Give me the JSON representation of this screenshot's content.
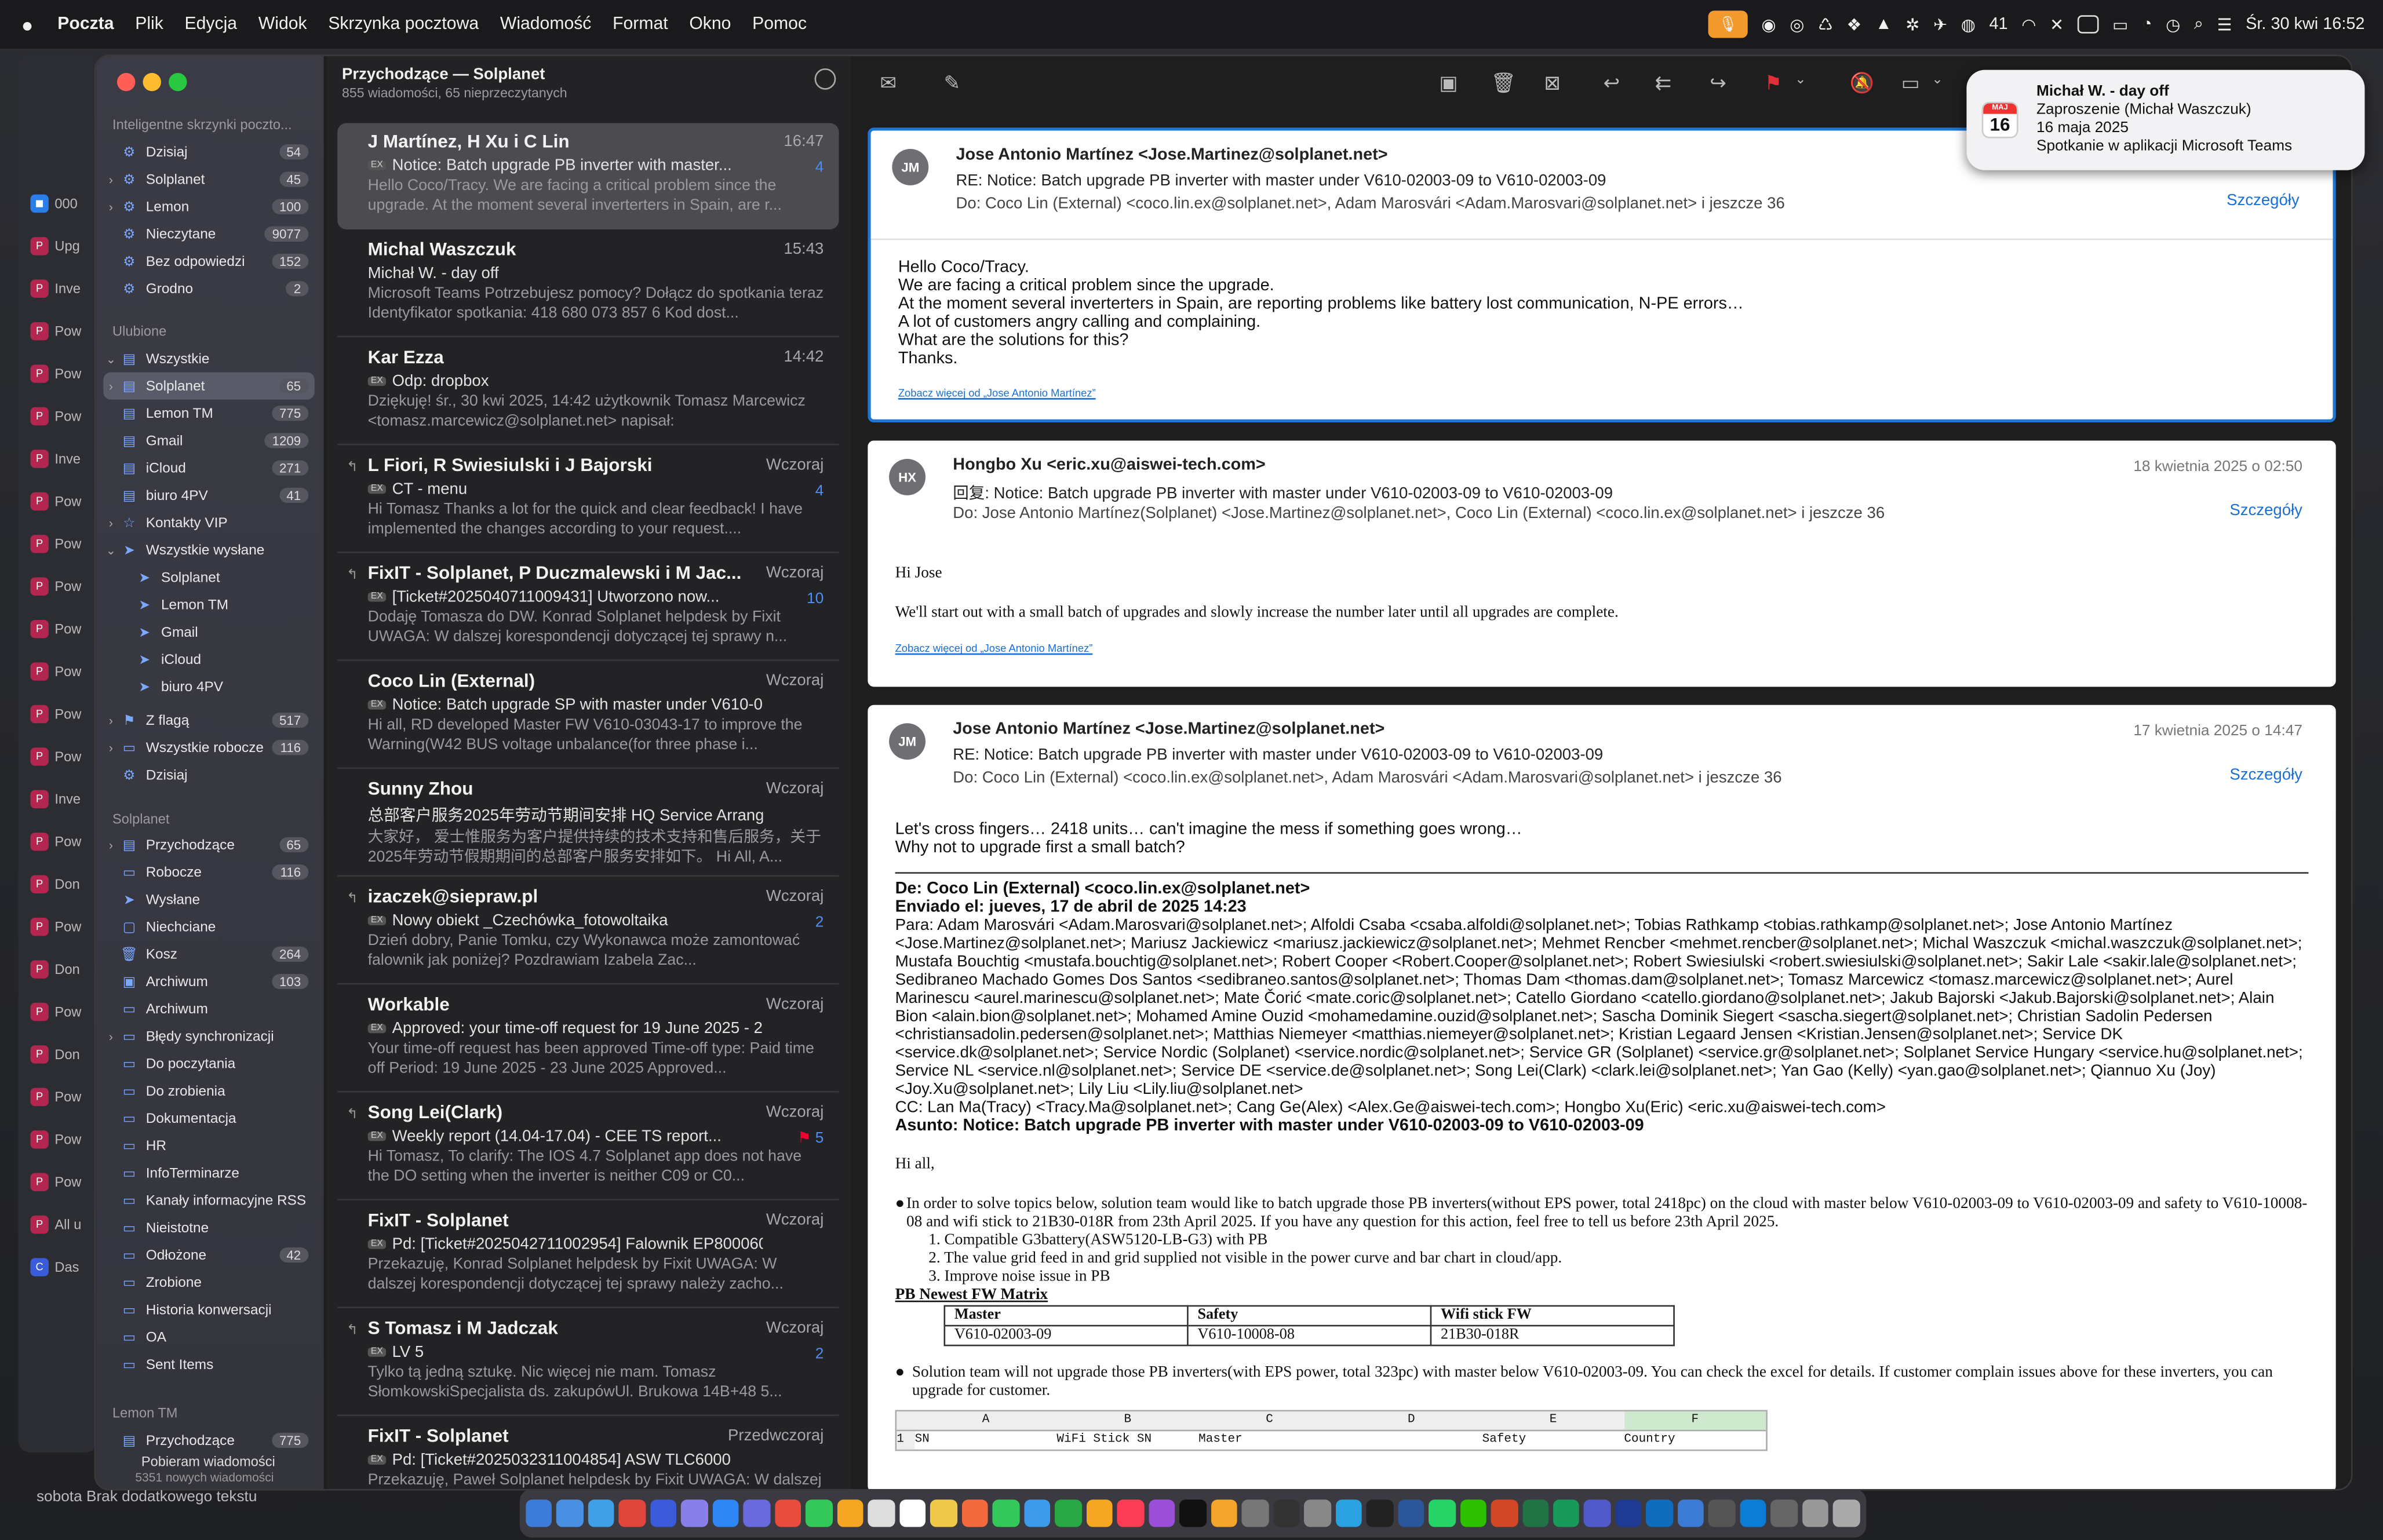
{
  "menubar": {
    "app": "Poczta",
    "items": [
      "Plik",
      "Edycja",
      "Widok",
      "Skrzynka pocztowa",
      "Wiadomość",
      "Format",
      "Okno",
      "Pomoc"
    ],
    "status_count": "41",
    "clock": "Śr. 30 kwi  16:52"
  },
  "sidebar": {
    "smart_header": "Inteligentne skrzynki poczto...",
    "smart": [
      {
        "label": "Dzisiaj",
        "count": "54"
      },
      {
        "label": "Solplanet",
        "count": "45"
      },
      {
        "label": "Lemon",
        "count": "100"
      },
      {
        "label": "Nieczytane",
        "count": "9077"
      },
      {
        "label": "Bez odpowiedzi",
        "count": "152"
      },
      {
        "label": "Grodno",
        "count": "2"
      }
    ],
    "fav_header": "Ulubione",
    "fav": [
      {
        "label": "Wszystkie",
        "count": ""
      },
      {
        "label": "Solplanet",
        "count": "65"
      },
      {
        "label": "Lemon TM",
        "count": "775"
      },
      {
        "label": "Gmail",
        "count": "1209"
      },
      {
        "label": "iCloud",
        "count": "271"
      },
      {
        "label": "biuro 4PV",
        "count": "41"
      },
      {
        "label": "Kontakty VIP",
        "count": ""
      },
      {
        "label": "Wszystkie wysłane",
        "count": ""
      },
      {
        "label": "Solplanet",
        "count": ""
      },
      {
        "label": "Lemon TM",
        "count": ""
      },
      {
        "label": "Gmail",
        "count": ""
      },
      {
        "label": "iCloud",
        "count": ""
      },
      {
        "label": "biuro 4PV",
        "count": ""
      },
      {
        "label": "Z flagą",
        "count": "517"
      },
      {
        "label": "Wszystkie robocze",
        "count": "116"
      },
      {
        "label": "Dzisiaj",
        "count": ""
      }
    ],
    "sol_header": "Solplanet",
    "sol": [
      {
        "label": "Przychodzące",
        "count": "65"
      },
      {
        "label": "Robocze",
        "count": "116"
      },
      {
        "label": "Wysłane",
        "count": ""
      },
      {
        "label": "Niechciane",
        "count": ""
      },
      {
        "label": "Kosz",
        "count": "264"
      },
      {
        "label": "Archiwum",
        "count": "103"
      },
      {
        "label": "Archiwum",
        "count": ""
      },
      {
        "label": "Błędy synchronizacji",
        "count": ""
      },
      {
        "label": "Do poczytania",
        "count": ""
      },
      {
        "label": "Do zrobienia",
        "count": ""
      },
      {
        "label": "Dokumentacja",
        "count": ""
      },
      {
        "label": "HR",
        "count": ""
      },
      {
        "label": "InfoTerminarze",
        "count": ""
      },
      {
        "label": "Kanały informacyjne RSS",
        "count": ""
      },
      {
        "label": "Nieistotne",
        "count": ""
      },
      {
        "label": "Odłożone",
        "count": "42"
      },
      {
        "label": "Zrobione",
        "count": ""
      },
      {
        "label": "Historia konwersacji",
        "count": ""
      },
      {
        "label": "OA",
        "count": ""
      },
      {
        "label": "Sent Items",
        "count": ""
      }
    ],
    "lemon_header": "Lemon TM",
    "lemon": [
      {
        "label": "Przychodzące",
        "count": "775"
      }
    ],
    "status1": "Pobieram wiadomości",
    "status2": "5351 nowych wiadomości"
  },
  "list": {
    "title": "Przychodzące — Solplanet",
    "sub": "855 wiadomości, 65 nieprzeczytanych",
    "messages": [
      {
        "from": "J Martínez, H Xu i C Lin",
        "time": "16:47",
        "subj": "Notice: Batch upgrade PB inverter with master...",
        "prev": "Hello Coco/Tracy. We are facing a critical problem since the upgrade. At the moment several inverterters in Spain, are r...",
        "count": "4"
      },
      {
        "from": "Michal Waszczuk",
        "time": "15:43",
        "subj": "Michał W. - day off",
        "prev": "Microsoft Teams Potrzebujesz pomocy? Dołącz do spotkania teraz Identyfikator spotkania: 418 680 073 857 6 Kod dost...",
        "count": ""
      },
      {
        "from": "Kar Ezza",
        "time": "14:42",
        "subj": "Odp: dropbox",
        "prev": "Dziękuję! śr., 30 kwi 2025, 14:42 użytkownik Tomasz Marcewicz <tomasz.marcewicz@solplanet.net> napisał:",
        "count": ""
      },
      {
        "from": "L Fiori, R Swiesiulski i J Bajorski",
        "time": "Wczoraj",
        "subj": "CT - menu",
        "prev": "Hi Tomasz Thanks a lot for the quick and clear feedback! I have implemented the changes according to your request....",
        "count": "4"
      },
      {
        "from": "FixIT - Solplanet, P Duczmalewski i M Jac...",
        "time": "Wczoraj",
        "subj": "[Ticket#2025040711009431] Utworzono now...",
        "prev": "Dodaję Tomasza do DW. Konrad Solplanet helpdesk by Fixit UWAGA: W dalszej korespondencji dotyczącej tej sprawy n...",
        "count": "10"
      },
      {
        "from": "Coco Lin (External)",
        "time": "Wczoraj",
        "subj": "Notice: Batch upgrade SP with master under V610-03...",
        "prev": "Hi all, RD developed Master FW V610-03043-17 to improve the Warning(W42 BUS voltage unbalance(for three phase i...",
        "count": ""
      },
      {
        "from": "Sunny Zhou",
        "time": "Wczoraj",
        "subj": "总部客户服务2025年劳动节期间安排 HQ Service Arrange...",
        "prev": "大家好， 爱士惟服务为客户提供持续的技术支持和售后服务，关于2025年劳动节假期期间的总部客户服务安排如下。 Hi All, A...",
        "count": ""
      },
      {
        "from": "izaczek@siepraw.pl",
        "time": "Wczoraj",
        "subj": "Nowy obiekt _Czechówka_fotowoltaika",
        "prev": "Dzień dobry, Panie Tomku, czy Wykonawca może zamontować falownik jak poniżej? Pozdrawiam Izabela Zac...",
        "count": "2"
      },
      {
        "from": "Workable",
        "time": "Wczoraj",
        "subj": "Approved: your time-off request for 19 June 2025 - 2...",
        "prev": "Your time-off request has been approved Time-off type: Paid time off Period: 19 June 2025 - 23 June 2025 Approved...",
        "count": ""
      },
      {
        "from": "Song Lei(Clark)",
        "time": "Wczoraj",
        "subj": "Weekly report (14.04-17.04) - CEE TS report...",
        "prev": "Hi Tomasz, To clarify: The IOS 4.7 Solplanet app does not have the DO setting when the inverter is neither C09 or C0...",
        "count": "5"
      },
      {
        "from": "FixIT - Solplanet",
        "time": "Wczoraj",
        "subj": "Pd: [Ticket#2025042711002954] Falownik EP800060...",
        "prev": "Przekazuję, Konrad Solplanet helpdesk by Fixit UWAGA: W dalszej korespondencji dotyczącej tej sprawy należy zacho...",
        "count": ""
      },
      {
        "from": "S Tomasz i M Jadczak",
        "time": "Wczoraj",
        "subj": "LV 5",
        "prev": "Tylko tą jedną sztukę. Nic więcej nie mam. Tomasz SłomkowskiSpecjalista ds. zakupówUl. Brukowa 14B+48 5...",
        "count": "2"
      },
      {
        "from": "FixIT - Solplanet",
        "time": "Przedwczoraj",
        "subj": "Pd: [Ticket#2025032311004854] ASW TLC6000",
        "prev": "Przekazuję, Paweł Solplanet helpdesk by Fixit UWAGA: W dalszej korespondencji dotyczącej tej sprawy należy zacho...",
        "count": ""
      }
    ]
  },
  "reader": {
    "m1": {
      "initials": "JM",
      "from": "Jose Antonio Martínez <Jose.Martinez@solplanet.net>",
      "subj": "RE: Notice: Batch upgrade PB inverter with master under V610-02003-09 to V610-02003-09",
      "to": "Do:  Coco Lin (External) <coco.lin.ex@solplanet.net>,    Adam Marosvári <Adam.Marosvari@solplanet.net>    i jeszcze 36",
      "details": "Szczegóły",
      "lines": [
        "Hello Coco/Tracy.",
        "We are facing a critical problem since the upgrade.",
        "At the moment several inverterters in Spain, are reporting problems like battery lost communication, N-PE errors…",
        "A lot of customers angry calling and complaining.",
        "What are the solutions for this?",
        "Thanks."
      ],
      "more": "Zobacz więcej od „Jose Antonio Martínez”"
    },
    "m2": {
      "initials": "HX",
      "from": "Hongbo Xu <eric.xu@aiswei-tech.com>",
      "date": "18 kwietnia 2025 o 02:50",
      "subj": "回复: Notice: Batch upgrade PB inverter with master under V610-02003-09 to V610-02003-09",
      "to": "Do:  Jose Antonio Martínez(Solplanet) <Jose.Martinez@solplanet.net>,    Coco Lin (External) <coco.lin.ex@solplanet.net>    i jeszcze 36",
      "details": "Szczegóły",
      "l1": "Hi Jose",
      "l2": "We'll start out with a small batch of upgrades and slowly increase the number later until all upgrades are complete.",
      "more": "Zobacz więcej od „Jose Antonio Martínez”"
    },
    "m3": {
      "initials": "JM",
      "from": "Jose Antonio Martínez <Jose.Martinez@solplanet.net>",
      "date": "17 kwietnia 2025 o 14:47",
      "subj": "RE: Notice: Batch upgrade PB inverter with master under V610-02003-09 to V610-02003-09",
      "to": "Do:  Coco Lin (External) <coco.lin.ex@solplanet.net>,    Adam Marosvári <Adam.Marosvari@solplanet.net>    i jeszcze 36",
      "details": "Szczegóły",
      "l1": "Let's cross fingers… 2418 units… can't imagine the mess if something goes wrong…",
      "l2": "Why not to upgrade first a small batch?",
      "de": "De: Coco Lin (External) <coco.lin.ex@solplanet.net>",
      "enviado": "Enviado el: jueves, 17 de abril de 2025 14:23",
      "para": "Para: Adam Marosvári <Adam.Marosvari@solplanet.net>; Alfoldi Csaba <csaba.alfoldi@solplanet.net>; Tobias Rathkamp <tobias.rathkamp@solplanet.net>; Jose Antonio Martínez <Jose.Martinez@solplanet.net>; Mariusz Jackiewicz <mariusz.jackiewicz@solplanet.net>; Mehmet Rencber <mehmet.rencber@solplanet.net>; Michal Waszczuk <michal.waszczuk@solplanet.net>; Mustafa Bouchtig <mustafa.bouchtig@solplanet.net>; Robert Cooper <Robert.Cooper@solplanet.net>; Robert Swiesiulski <robert.swiesiulski@solplanet.net>; Sakir Lale <sakir.lale@solplanet.net>; Sedibraneo Machado Gomes Dos Santos <sedibraneo.santos@solplanet.net>; Thomas Dam <thomas.dam@solplanet.net>; Tomasz Marcewicz <tomasz.marcewicz@solplanet.net>; Aurel Marinescu <aurel.marinescu@solplanet.net>; Mate Čorić <mate.coric@solplanet.net>; Catello Giordano <catello.giordano@solplanet.net>; Jakub Bajorski <Jakub.Bajorski@solplanet.net>; Alain Bion <alain.bion@solplanet.net>; Mohamed Amine Ouzid <mohamedamine.ouzid@solplanet.net>; Sascha Dominik Siegert <sascha.siegert@solplanet.net>; Christian Sadolin Pedersen <christiansadolin.pedersen@solplanet.net>; Matthias Niemeyer <matthias.niemeyer@solplanet.net>; Kristian Legaard Jensen <Kristian.Jensen@solplanet.net>; Service DK <service.dk@solplanet.net>; Service Nordic (Solplanet) <service.nordic@solplanet.net>; Service GR (Solplanet) <service.gr@solplanet.net>; Solplanet Service Hungary <service.hu@solplanet.net>; Service NL <service.nl@solplanet.net>; Service DE <service.de@solplanet.net>; Song Lei(Clark) <clark.lei@solplanet.net>; Yan Gao (Kelly) <yan.gao@solplanet.net>; Qiannuo Xu (Joy) <Joy.Xu@solplanet.net>; Lily Liu <Lily.liu@solplanet.net>",
      "cc": "CC: Lan Ma(Tracy) <Tracy.Ma@solplanet.net>; Cang Ge(Alex) <Alex.Ge@aiswei-tech.com>; Hongbo Xu(Eric) <eric.xu@aiswei-tech.com>",
      "asunto": "Asunto: Notice: Batch upgrade PB inverter with master under V610-02003-09 to V610-02003-09",
      "hiall": "Hi all,",
      "bullet1": "In order to solve topics below, solution team would like to batch upgrade those PB inverters(without EPS power, total 2418pc) on the cloud with master below V610-02003-09 to V610-02003-09 and safety to V610-10008-08 and wifi stick to 21B30-018R from 23th April 2025. If you have any question for this action, feel free to tell us before 23th April 2025.",
      "items": [
        "1. Compatible G3battery(ASW5120-LB-G3)  with PB",
        "2. The value grid feed in and grid supplied not visible in the power curve and bar chart in cloud/app.",
        "3. Improve noise issue in PB"
      ],
      "matrix_title": "PB Newest FW Matrix",
      "matrix_head": [
        "Master",
        "Safety",
        "Wifi stick FW"
      ],
      "matrix_row": [
        "V610-02003-09",
        "V610-10008-08",
        "21B30-018R"
      ],
      "bullet2": "Solution team will not upgrade those PB inverters(with EPS power, total 323pc) with master below V610-02003-09. You can check the excel for details. If customer complain issues above for these inverters, you can upgrade for customer.",
      "sheet_cols": [
        "A",
        "B",
        "C",
        "D",
        "E",
        "F"
      ],
      "sheet_head": [
        "SN",
        "WiFi Stick SN",
        "Master",
        "",
        "Safety",
        "Country"
      ]
    }
  },
  "notif": {
    "title": "Michał W. - day off",
    "l1": "Zaproszenie (Michał Waszczuk)",
    "l2": "16 maja 2025",
    "l3": "Spotkanie w aplikacji Microsoft Teams",
    "month": "MAJ",
    "day": "16"
  },
  "bottom": "sobota  Brak dodatkowego tekstu"
}
